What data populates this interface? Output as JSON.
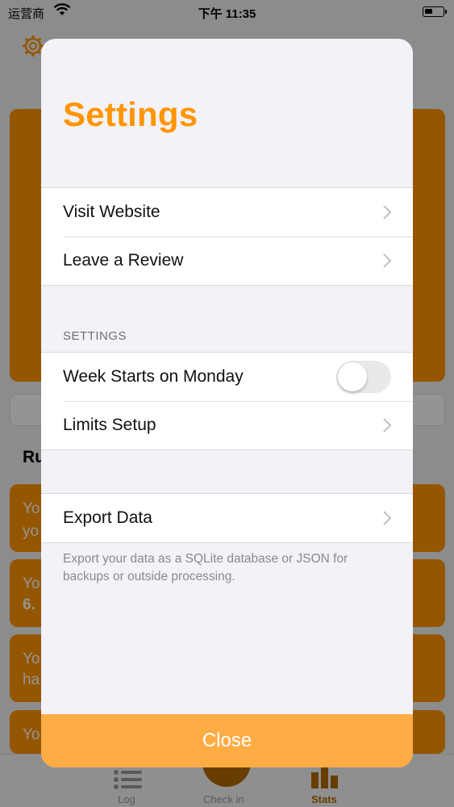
{
  "status_bar": {
    "carrier": "运营商",
    "time": "下午 11:35"
  },
  "background": {
    "section_title": "Ru",
    "card_snippets": [
      "Yo",
      "yo",
      "Yo",
      "6.",
      "Yo",
      "ha",
      "Yo"
    ],
    "tabs": [
      {
        "label": "Log",
        "icon": "list-icon"
      },
      {
        "label": "Check in",
        "icon": "check-in-icon"
      },
      {
        "label": "Stats",
        "icon": "stats-icon"
      }
    ],
    "accent_color": "#ff9500"
  },
  "modal": {
    "title": "Settings",
    "group1": [
      {
        "label": "Visit Website"
      },
      {
        "label": "Leave a Review"
      }
    ],
    "settings_section_header": "SETTINGS",
    "settings_group": {
      "week_toggle_label": "Week Starts on Monday",
      "week_toggle_on": false,
      "limits_label": "Limits Setup"
    },
    "export_label": "Export Data",
    "export_footer": "Export your data as a SQLite database or JSON for backups or outside processing.",
    "close_label": "Close"
  }
}
